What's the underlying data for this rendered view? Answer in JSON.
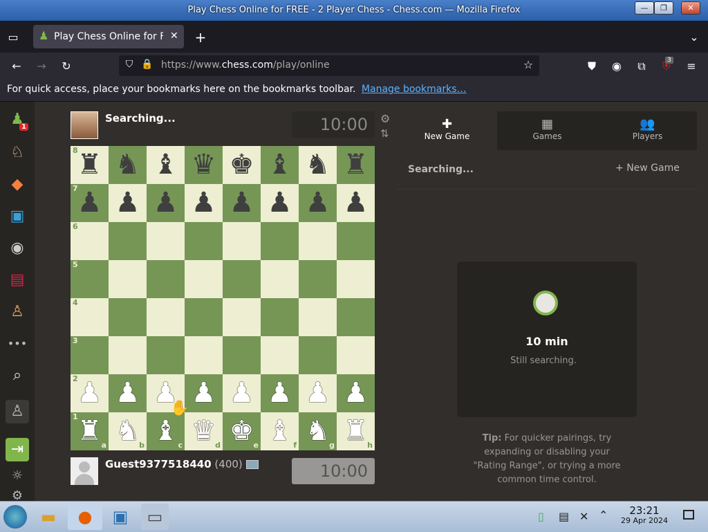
{
  "window": {
    "title": "Play Chess Online for FREE - 2 Player Chess - Chess.com — Mozilla Firefox",
    "buttons": {
      "minimize": "—",
      "maximize": "❐",
      "close": "✕"
    }
  },
  "browser": {
    "tab_title": "Play Chess Online for FR",
    "new_tab": "+",
    "url_prefix": "https://www.",
    "url_domain": "chess.com",
    "url_path": "/play/online",
    "extension_badge": "3",
    "bookmarks_text": "For quick access, place your bookmarks here on the bookmarks toolbar.",
    "bookmarks_link": "Manage bookmarks…"
  },
  "sidebar": {
    "items": [
      {
        "icon": "pawn-logo-icon",
        "glyph": "♟",
        "badge": "1"
      },
      {
        "icon": "play-icon",
        "glyph": "♘"
      },
      {
        "icon": "puzzles-icon",
        "glyph": "◆"
      },
      {
        "icon": "learn-icon",
        "glyph": "▣"
      },
      {
        "icon": "watch-icon",
        "glyph": "◉"
      },
      {
        "icon": "news-icon",
        "glyph": "▤"
      },
      {
        "icon": "social-icon",
        "glyph": "♙"
      },
      {
        "icon": "more-icon",
        "glyph": "•••"
      },
      {
        "icon": "search-icon",
        "glyph": "⌕"
      },
      {
        "icon": "add-friend-icon",
        "glyph": "♙"
      },
      {
        "icon": "login-icon",
        "glyph": "⇥"
      },
      {
        "icon": "theme-icon",
        "glyph": "☼"
      },
      {
        "icon": "settings-icon",
        "glyph": "⚙"
      }
    ]
  },
  "game": {
    "top_player": {
      "name": "Searching...",
      "clock": "10:00"
    },
    "bottom_player": {
      "name": "Guest9377518440",
      "rating": "(400)",
      "clock": "10:00"
    },
    "ranks": [
      "8",
      "7",
      "6",
      "5",
      "4",
      "3",
      "2",
      "1"
    ],
    "files": [
      "a",
      "b",
      "c",
      "d",
      "e",
      "f",
      "g",
      "h"
    ],
    "board": [
      [
        "♜",
        "♞",
        "♝",
        "♛",
        "♚",
        "♝",
        "♞",
        "♜"
      ],
      [
        "♟",
        "♟",
        "♟",
        "♟",
        "♟",
        "♟",
        "♟",
        "♟"
      ],
      [
        "",
        "",
        "",
        "",
        "",
        "",
        "",
        ""
      ],
      [
        "",
        "",
        "",
        "",
        "",
        "",
        "",
        ""
      ],
      [
        "",
        "",
        "",
        "",
        "",
        "",
        "",
        ""
      ],
      [
        "",
        "",
        "",
        "",
        "",
        "",
        "",
        ""
      ],
      [
        "♟",
        "♟",
        "♟",
        "♟",
        "♟",
        "♟",
        "♟",
        "♟"
      ],
      [
        "♜",
        "♞",
        "♝",
        "♛",
        "♚",
        "♝",
        "♞",
        "♜"
      ]
    ]
  },
  "panel": {
    "tabs": [
      {
        "label": "New Game",
        "icon": "plus-square-icon",
        "glyph": "✚"
      },
      {
        "label": "Games",
        "icon": "checkerboard-icon",
        "glyph": "▦"
      },
      {
        "label": "Players",
        "icon": "players-icon",
        "glyph": "👥"
      }
    ],
    "status": "Searching...",
    "new_game_button": "New Game",
    "search_card": {
      "time": "10 min",
      "status": "Still searching."
    },
    "tip_label": "Tip:",
    "tip_text": "For quicker pairings, try expanding or disabling your \"Rating Range\", or trying a more common time control."
  },
  "taskbar": {
    "time": "23:21",
    "date": "29 Apr 2024"
  },
  "colors": {
    "board_light": "#eeeed2",
    "board_dark": "#769656",
    "accent_green": "#81b64c",
    "link": "#5db3ff"
  }
}
